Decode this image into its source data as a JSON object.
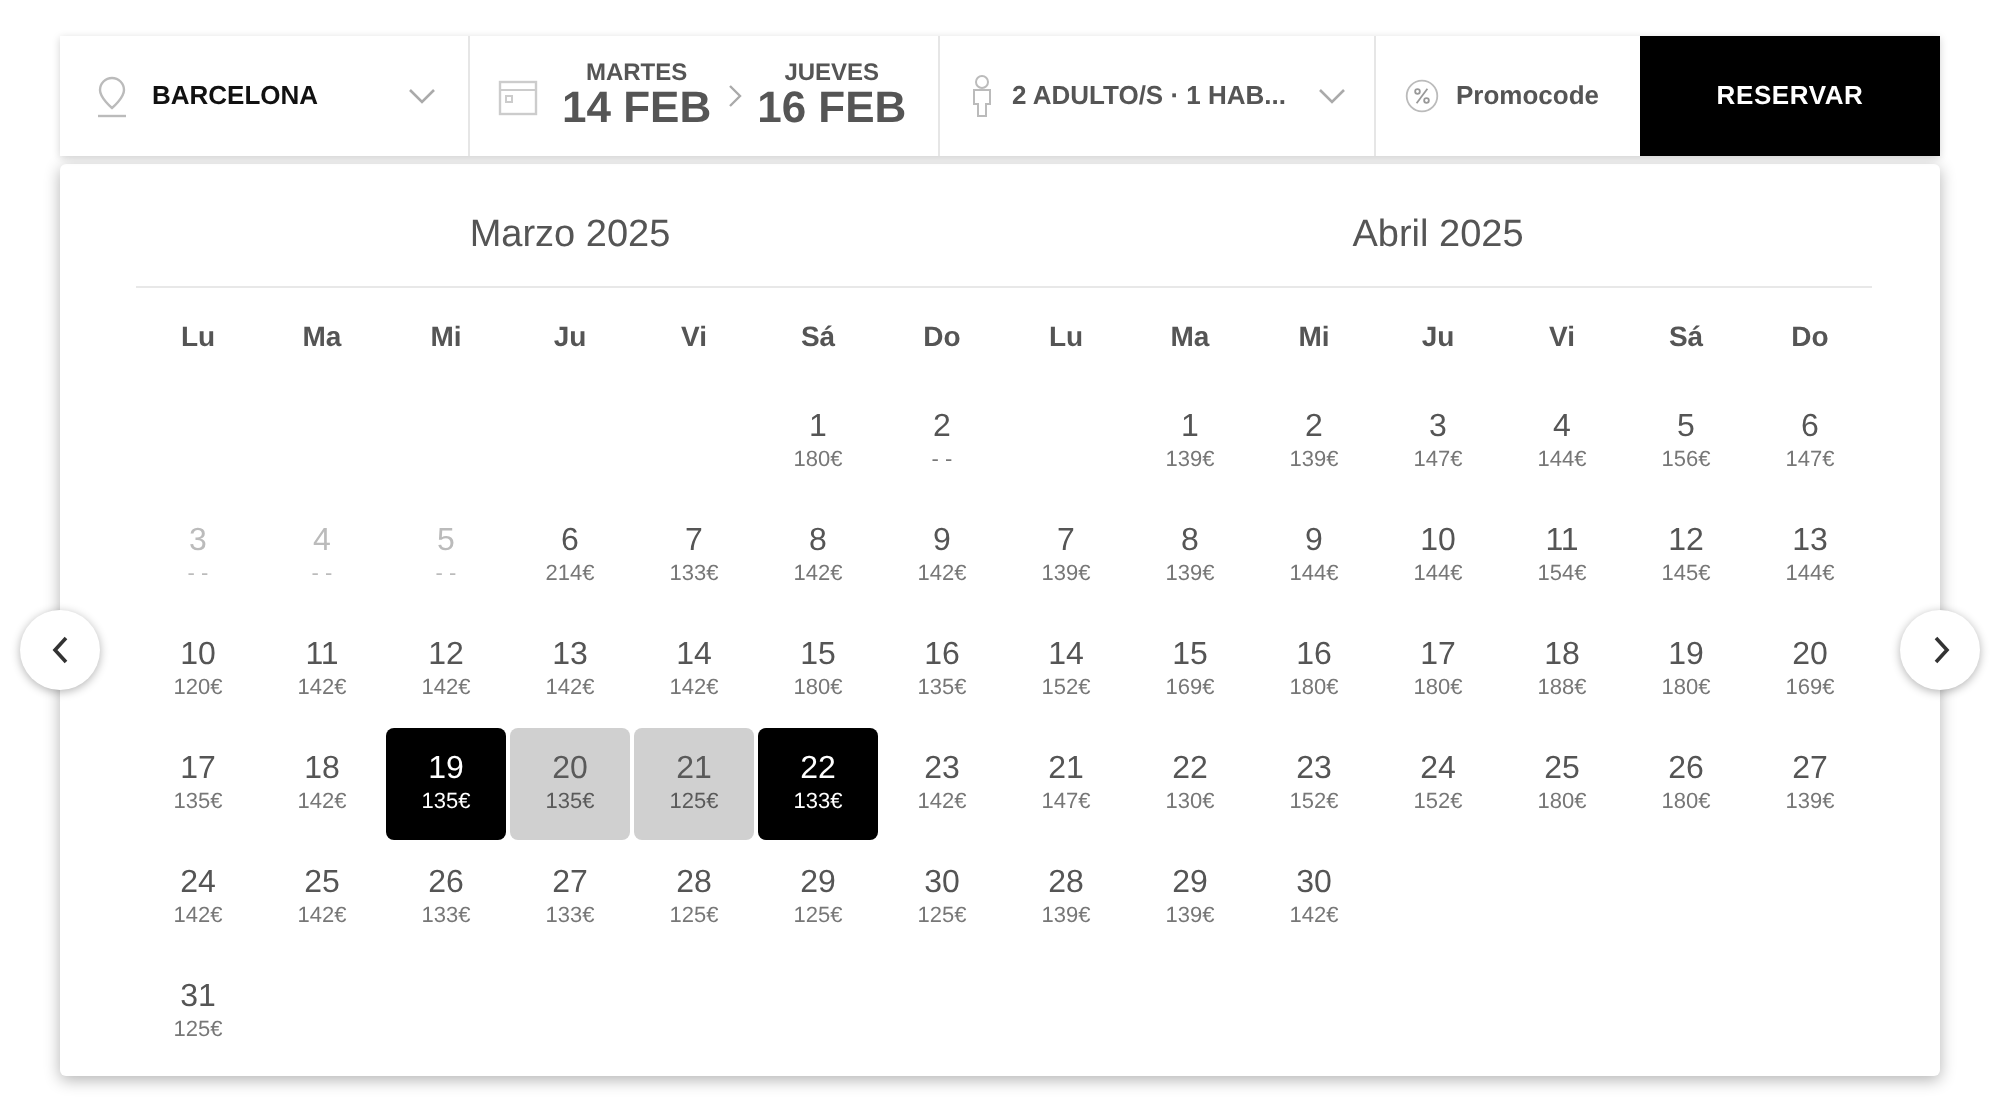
{
  "search_bar": {
    "location": "BARCELONA",
    "checkin": {
      "weekday": "MARTES",
      "date": "14 FEB"
    },
    "checkout": {
      "weekday": "JUEVES",
      "date": "16 FEB"
    },
    "guests": "2 ADULTO/S · 1 HAB...",
    "promocode": {
      "placeholder": "Promocode"
    },
    "book_button": "RESERVAR"
  },
  "months": [
    {
      "title": "Marzo 2025",
      "weekdays": [
        "Lu",
        "Ma",
        "Mi",
        "Ju",
        "Vi",
        "Sá",
        "Do"
      ],
      "weeks": [
        [
          {
            "kind": "blank"
          },
          {
            "kind": "blank"
          },
          {
            "kind": "blank"
          },
          {
            "kind": "blank"
          },
          {
            "kind": "blank"
          },
          {
            "day": "1",
            "price": "180€",
            "kind": "open",
            "selected": false
          },
          {
            "day": "2",
            "price": "- -",
            "kind": "open",
            "selected": false
          }
        ],
        [
          {
            "day": "3",
            "price": "- -",
            "kind": "past",
            "selected": false
          },
          {
            "day": "4",
            "price": "- -",
            "kind": "past",
            "selected": false
          },
          {
            "day": "5",
            "price": "- -",
            "kind": "past",
            "selected": false
          },
          {
            "day": "6",
            "price": "214€",
            "kind": "open",
            "selected": false
          },
          {
            "day": "7",
            "price": "133€",
            "kind": "open",
            "selected": false
          },
          {
            "day": "8",
            "price": "142€",
            "kind": "open",
            "selected": false
          },
          {
            "day": "9",
            "price": "142€",
            "kind": "open",
            "selected": false
          }
        ],
        [
          {
            "day": "10",
            "price": "120€",
            "kind": "open",
            "selected": false
          },
          {
            "day": "11",
            "price": "142€",
            "kind": "open",
            "selected": false
          },
          {
            "day": "12",
            "price": "142€",
            "kind": "open",
            "selected": false
          },
          {
            "day": "13",
            "price": "142€",
            "kind": "open",
            "selected": false
          },
          {
            "day": "14",
            "price": "142€",
            "kind": "open",
            "selected": false
          },
          {
            "day": "15",
            "price": "180€",
            "kind": "open",
            "selected": false
          },
          {
            "day": "16",
            "price": "135€",
            "kind": "open",
            "selected": false
          }
        ],
        [
          {
            "day": "17",
            "price": "135€",
            "kind": "open",
            "selected": false
          },
          {
            "day": "18",
            "price": "142€",
            "kind": "open",
            "selected": false
          },
          {
            "day": "19",
            "price": "135€",
            "kind": "open",
            "selected": true
          },
          {
            "day": "20",
            "price": "135€",
            "kind": "range",
            "selected": false
          },
          {
            "day": "21",
            "price": "125€",
            "kind": "range",
            "selected": false
          },
          {
            "day": "22",
            "price": "133€",
            "kind": "open",
            "selected": true
          },
          {
            "day": "23",
            "price": "142€",
            "kind": "open",
            "selected": false
          }
        ],
        [
          {
            "day": "24",
            "price": "142€",
            "kind": "open",
            "selected": false
          },
          {
            "day": "25",
            "price": "142€",
            "kind": "open",
            "selected": false
          },
          {
            "day": "26",
            "price": "133€",
            "kind": "open",
            "selected": false
          },
          {
            "day": "27",
            "price": "133€",
            "kind": "open",
            "selected": false
          },
          {
            "day": "28",
            "price": "125€",
            "kind": "open",
            "selected": false
          },
          {
            "day": "29",
            "price": "125€",
            "kind": "open",
            "selected": false
          },
          {
            "day": "30",
            "price": "125€",
            "kind": "open",
            "selected": false
          }
        ],
        [
          {
            "day": "31",
            "price": "125€",
            "kind": "open",
            "selected": false
          }
        ]
      ]
    },
    {
      "title": "Abril 2025",
      "weekdays": [
        "Lu",
        "Ma",
        "Mi",
        "Ju",
        "Vi",
        "Sá",
        "Do"
      ],
      "weeks": [
        [
          {
            "kind": "blank"
          },
          {
            "day": "1",
            "price": "139€",
            "kind": "open",
            "selected": false
          },
          {
            "day": "2",
            "price": "139€",
            "kind": "open",
            "selected": false
          },
          {
            "day": "3",
            "price": "147€",
            "kind": "open",
            "selected": false
          },
          {
            "day": "4",
            "price": "144€",
            "kind": "open",
            "selected": false
          },
          {
            "day": "5",
            "price": "156€",
            "kind": "open",
            "selected": false
          },
          {
            "day": "6",
            "price": "147€",
            "kind": "open",
            "selected": false
          }
        ],
        [
          {
            "day": "7",
            "price": "139€",
            "kind": "open",
            "selected": false
          },
          {
            "day": "8",
            "price": "139€",
            "kind": "open",
            "selected": false
          },
          {
            "day": "9",
            "price": "144€",
            "kind": "open",
            "selected": false
          },
          {
            "day": "10",
            "price": "144€",
            "kind": "open",
            "selected": false
          },
          {
            "day": "11",
            "price": "154€",
            "kind": "open",
            "selected": false
          },
          {
            "day": "12",
            "price": "145€",
            "kind": "open",
            "selected": false
          },
          {
            "day": "13",
            "price": "144€",
            "kind": "open",
            "selected": false
          }
        ],
        [
          {
            "day": "14",
            "price": "152€",
            "kind": "open",
            "selected": false
          },
          {
            "day": "15",
            "price": "169€",
            "kind": "open",
            "selected": false
          },
          {
            "day": "16",
            "price": "180€",
            "kind": "open",
            "selected": false
          },
          {
            "day": "17",
            "price": "180€",
            "kind": "open",
            "selected": false
          },
          {
            "day": "18",
            "price": "188€",
            "kind": "open",
            "selected": false
          },
          {
            "day": "19",
            "price": "180€",
            "kind": "open",
            "selected": false
          },
          {
            "day": "20",
            "price": "169€",
            "kind": "open",
            "selected": false
          }
        ],
        [
          {
            "day": "21",
            "price": "147€",
            "kind": "open",
            "selected": false
          },
          {
            "day": "22",
            "price": "130€",
            "kind": "open",
            "selected": false
          },
          {
            "day": "23",
            "price": "152€",
            "kind": "open",
            "selected": false
          },
          {
            "day": "24",
            "price": "152€",
            "kind": "open",
            "selected": false
          },
          {
            "day": "25",
            "price": "180€",
            "kind": "open",
            "selected": false
          },
          {
            "day": "26",
            "price": "180€",
            "kind": "open",
            "selected": false
          },
          {
            "day": "27",
            "price": "139€",
            "kind": "open",
            "selected": false
          }
        ],
        [
          {
            "day": "28",
            "price": "139€",
            "kind": "open",
            "selected": false
          },
          {
            "day": "29",
            "price": "139€",
            "kind": "open",
            "selected": false
          },
          {
            "day": "30",
            "price": "142€",
            "kind": "open",
            "selected": false
          }
        ]
      ]
    }
  ]
}
